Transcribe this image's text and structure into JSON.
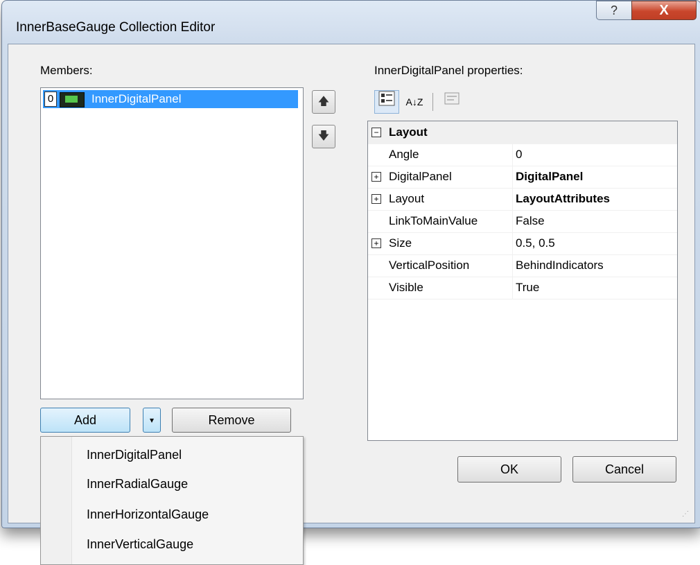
{
  "window": {
    "title": "InnerBaseGauge Collection Editor",
    "help_glyph": "?",
    "close_glyph": "X"
  },
  "members": {
    "label": "Members:",
    "items": [
      {
        "index": "0",
        "name": "InnerDigitalPanel"
      }
    ],
    "up_glyph": "🡅",
    "down_glyph": "🡇"
  },
  "buttons": {
    "add": "Add",
    "add_drop": "▾",
    "remove": "Remove",
    "ok": "OK",
    "cancel": "Cancel"
  },
  "properties": {
    "label": "InnerDigitalPanel properties:",
    "category": "Layout",
    "rows": [
      {
        "name": "Angle",
        "value": "0",
        "expand": ""
      },
      {
        "name": "DigitalPanel",
        "value": "DigitalPanel",
        "expand": "+"
      },
      {
        "name": "Layout",
        "value": "LayoutAttributes",
        "expand": "+"
      },
      {
        "name": "LinkToMainValue",
        "value": "False",
        "expand": ""
      },
      {
        "name": "Size",
        "value": "0.5, 0.5",
        "expand": "+"
      },
      {
        "name": "VerticalPosition",
        "value": "BehindIndicators",
        "expand": ""
      },
      {
        "name": "Visible",
        "value": "True",
        "expand": ""
      }
    ],
    "category_toggle": "−",
    "sort_glyph": "A↓Z"
  },
  "add_menu": {
    "items": [
      "InnerDigitalPanel",
      "InnerRadialGauge",
      "InnerHorizontalGauge",
      "InnerVerticalGauge"
    ]
  },
  "colors": {
    "selection": "#3399ff",
    "close": "#c9462c"
  }
}
